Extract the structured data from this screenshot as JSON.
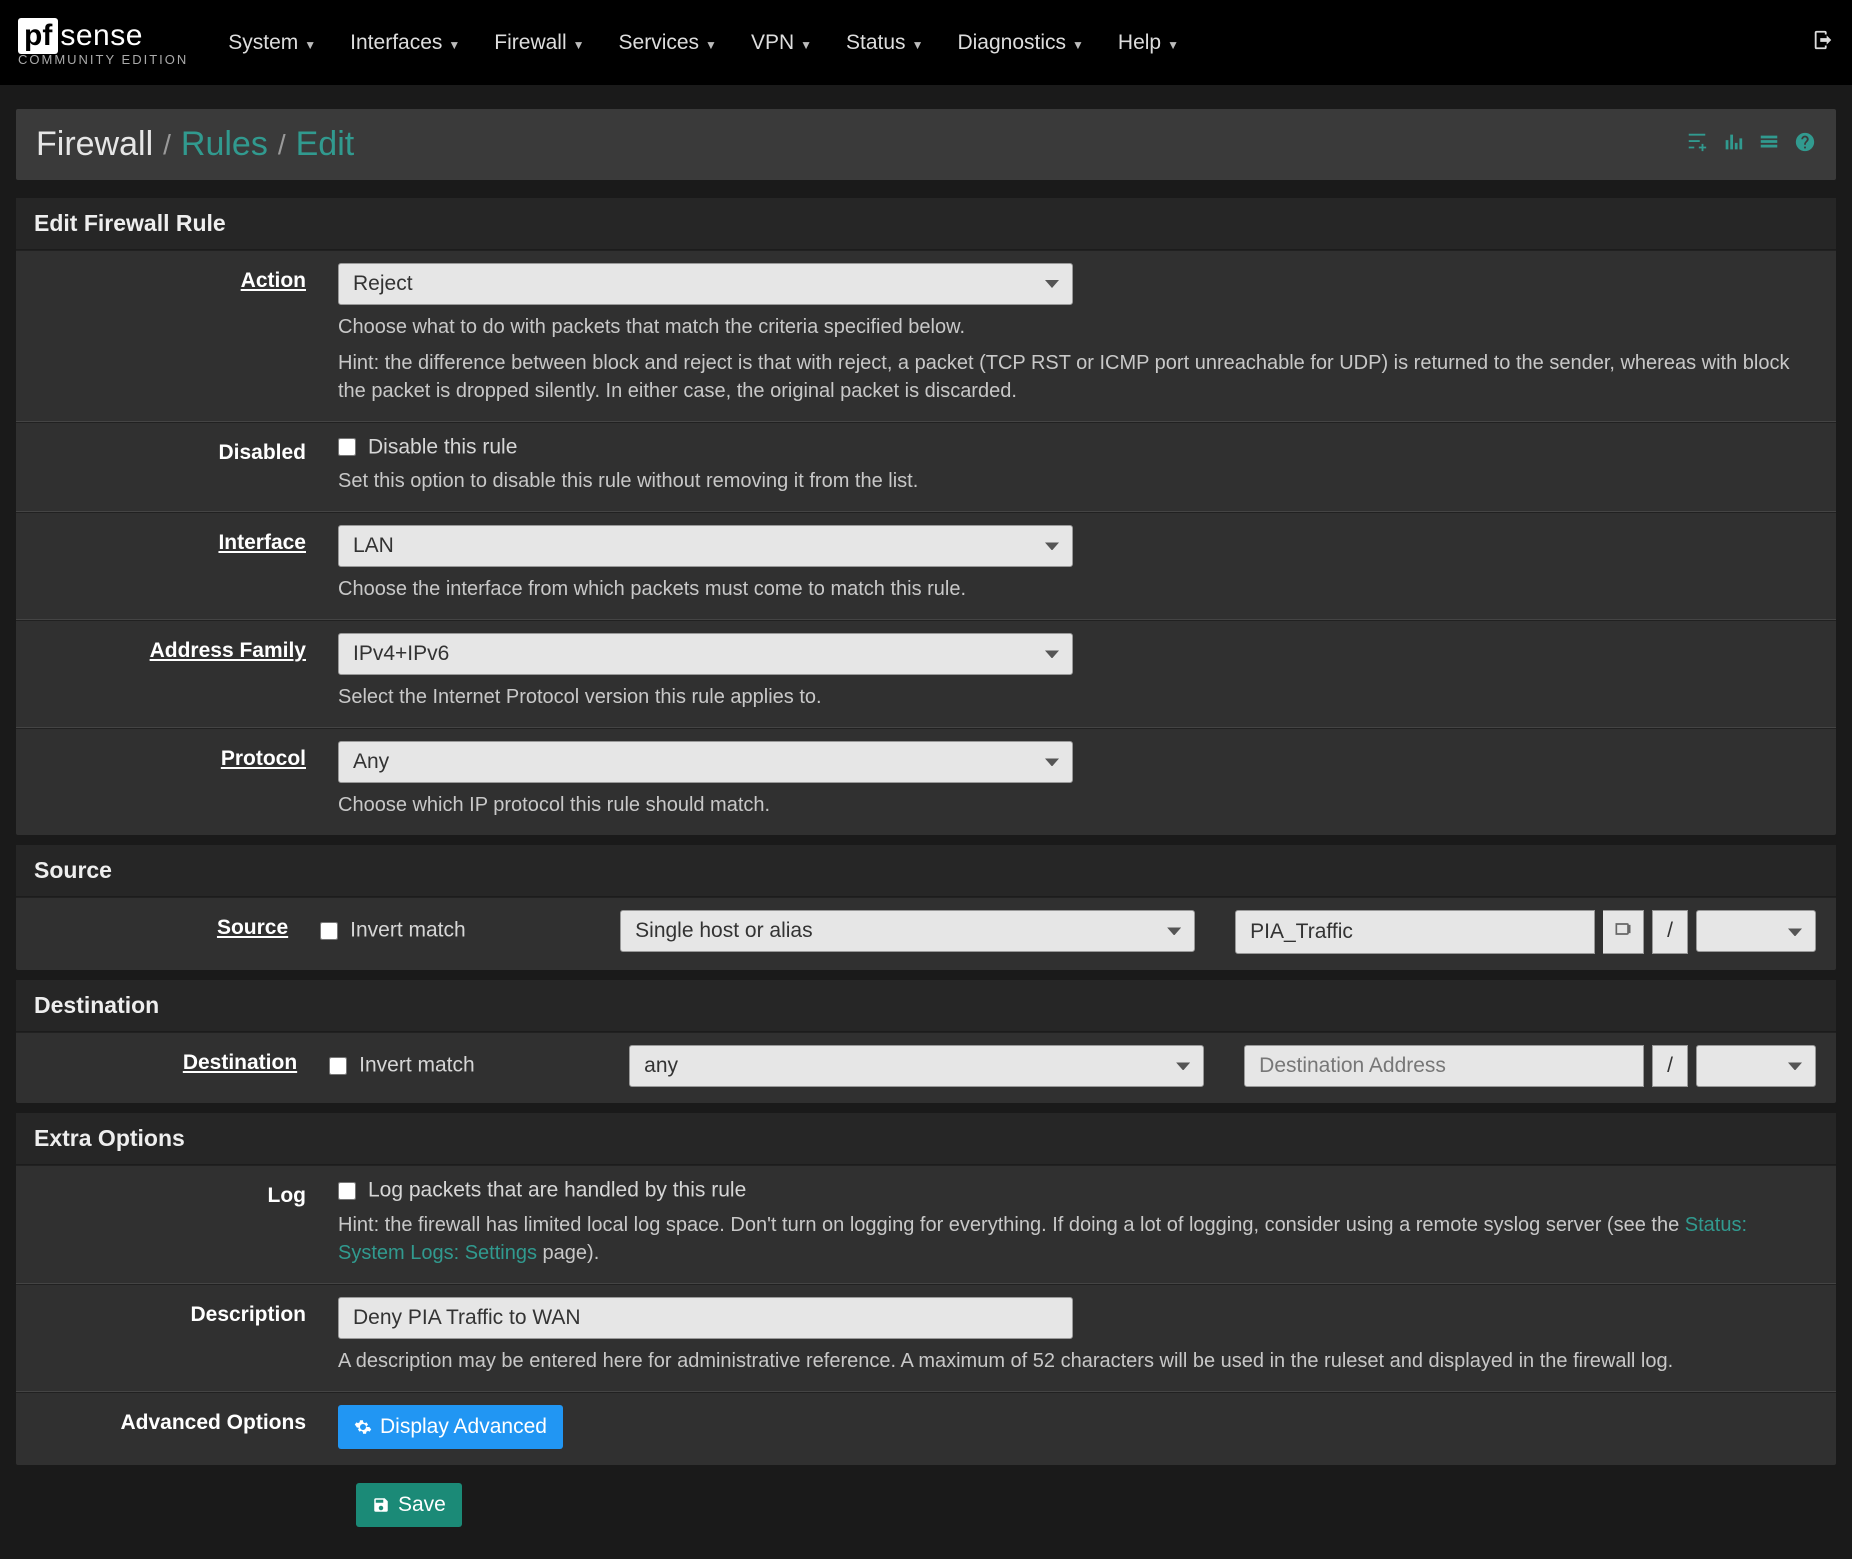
{
  "nav": {
    "items": [
      "System",
      "Interfaces",
      "Firewall",
      "Services",
      "VPN",
      "Status",
      "Diagnostics",
      "Help"
    ]
  },
  "logo": {
    "pf": "pf",
    "sense": "sense",
    "edition": "COMMUNITY EDITION"
  },
  "crumb": {
    "root": "Firewall",
    "mid": "Rules",
    "leaf": "Edit"
  },
  "panels": {
    "edit": {
      "title": "Edit Firewall Rule",
      "action": {
        "label": "Action",
        "value": "Reject",
        "help": "Choose what to do with packets that match the criteria specified below.",
        "help2": "Hint: the difference between block and reject is that with reject, a packet (TCP RST or ICMP port unreachable for UDP) is returned to the sender, whereas with block the packet is dropped silently. In either case, the original packet is discarded."
      },
      "disabled": {
        "label": "Disabled",
        "chk_label": "Disable this rule",
        "help": "Set this option to disable this rule without removing it from the list."
      },
      "interface": {
        "label": "Interface",
        "value": "LAN",
        "help": "Choose the interface from which packets must come to match this rule."
      },
      "family": {
        "label": "Address Family",
        "value": "IPv4+IPv6",
        "help": "Select the Internet Protocol version this rule applies to."
      },
      "protocol": {
        "label": "Protocol",
        "value": "Any",
        "help": "Choose which IP protocol this rule should match."
      }
    },
    "source": {
      "title": "Source",
      "label": "Source",
      "invert": "Invert match",
      "type": "Single host or alias",
      "addr": "PIA_Traffic",
      "slash": "/"
    },
    "dest": {
      "title": "Destination",
      "label": "Destination",
      "invert": "Invert match",
      "type": "any",
      "addr_ph": "Destination Address",
      "slash": "/"
    },
    "extra": {
      "title": "Extra Options",
      "log": {
        "label": "Log",
        "chk_label": "Log packets that are handled by this rule",
        "help1": "Hint: the firewall has limited local log space. Don't turn on logging for everything. If doing a lot of logging, consider using a remote syslog server (see the ",
        "link": "Status: System Logs: Settings",
        "help2": " page)."
      },
      "desc": {
        "label": "Description",
        "value": "Deny PIA Traffic to WAN",
        "help": "A description may be entered here for administrative reference. A maximum of 52 characters will be used in the ruleset and displayed in the firewall log."
      },
      "adv": {
        "label": "Advanced Options",
        "btn": "Display Advanced"
      }
    }
  },
  "save": "Save"
}
